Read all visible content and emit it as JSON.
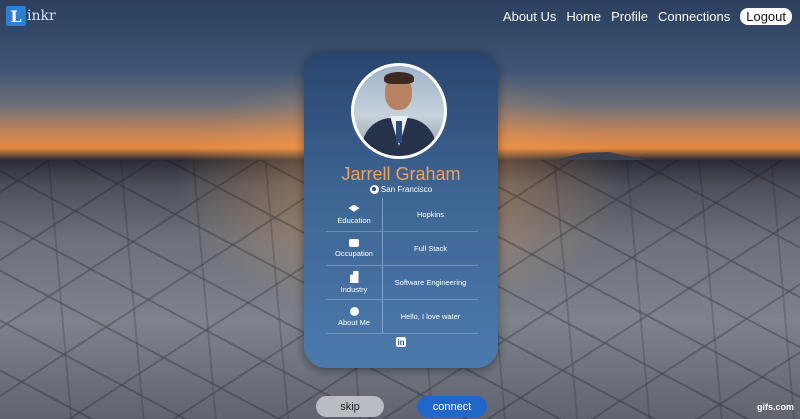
{
  "brand": {
    "logo_letter": "L",
    "logo_rest": "inkr",
    "accent": "#2d7fd3"
  },
  "nav": {
    "items": [
      "About Us",
      "Home",
      "Profile",
      "Connections"
    ],
    "logout": "Logout"
  },
  "profile": {
    "name": "Jarrell Graham",
    "location": "San Francisco",
    "name_color": "#f2a255",
    "fields": [
      {
        "icon": "graduation-cap-icon",
        "label": "Education",
        "value": "Hopkins"
      },
      {
        "icon": "briefcase-icon",
        "label": "Occupation",
        "value": "Full Stack"
      },
      {
        "icon": "building-icon",
        "label": "Industry",
        "value": "Software Engineering"
      },
      {
        "icon": "info-icon",
        "label": "About Me",
        "value": "Hello, I love water"
      }
    ],
    "linkedin_label": "in"
  },
  "actions": {
    "skip": "skip",
    "connect": "connect"
  },
  "watermark": "gifs.com"
}
